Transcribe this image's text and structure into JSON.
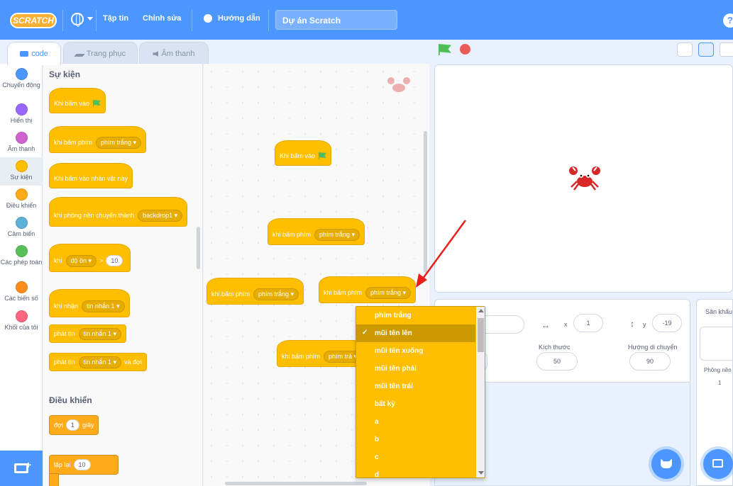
{
  "menubar": {
    "logo": "SCRATCH",
    "file": "Tập tin",
    "edit": "Chỉnh sửa",
    "tutorials": "Hướng dẫn",
    "project_title": "Dự án Scratch",
    "help": "?"
  },
  "tabs": {
    "code": "code",
    "costumes": "Trang phục",
    "sounds": "Âm thanh"
  },
  "categories": [
    {
      "label": "Chuyển động",
      "color": "#4c97ff"
    },
    {
      "label": "Hiển thị",
      "color": "#9966ff"
    },
    {
      "label": "Âm thanh",
      "color": "#cf63cf"
    },
    {
      "label": "Sự kiện",
      "color": "#ffbf00"
    },
    {
      "label": "Điều khiển",
      "color": "#ffab19"
    },
    {
      "label": "Cảm biến",
      "color": "#5cb1d6"
    },
    {
      "label": "Các phép toán",
      "color": "#59c059"
    },
    {
      "label": "Các biến số",
      "color": "#ff8c1a"
    },
    {
      "label": "Khối của tôi",
      "color": "#ff6680"
    }
  ],
  "palette": {
    "events_heading": "Sự kiện",
    "control_heading": "Điều khiển",
    "when_flag_clicked": "Khi bấm vào",
    "when_key_pressed": "khi bấm phím",
    "key_space": "phím trắng",
    "when_sprite_clicked": "Khi bấm vào nhân vật này",
    "when_backdrop_switches": "khi phông nền chuyển thành",
    "backdrop1": "backdrop1",
    "when_loudness": "khi",
    "loudness": "độ ồn",
    "gt": ">",
    "loudness_value": "10",
    "when_receive": "khi nhận",
    "message1": "tin nhắn 1",
    "broadcast": "phát tin",
    "broadcast_wait_suffix": "và đợi",
    "wait": "đợi",
    "wait_value": "1",
    "seconds": "giây",
    "repeat": "lặp lại",
    "repeat_value": "10"
  },
  "scripts": {
    "when_flag_clicked": "Khi bấm vào",
    "when_key_pressed": "khi bấm phím",
    "key_space": "phím trắng",
    "key_space_truncated": "phím trả"
  },
  "dropdown": {
    "options": [
      "phím trắng",
      "mũi tên lên",
      "mũi tên xuống",
      "mũi tên phải",
      "mũi tên trái",
      "bất kỳ",
      "a",
      "b",
      "c",
      "d"
    ],
    "selected_index": 1,
    "check": "✓"
  },
  "sprite_info": {
    "x_label": "x",
    "x_value": "1",
    "y_label": "y",
    "y_value": "-19",
    "size_label": "Kích thước",
    "size_value": "50",
    "direction_label": "Hướng di chuyển",
    "direction_value": "90"
  },
  "stage_pane": {
    "header": "Sân khấu",
    "backdrops_label": "Phông nền",
    "backdrops_count": "1"
  },
  "colors": {
    "menubar": "#4c97ff",
    "events": "#ffbf00",
    "control": "#ffab19",
    "annotation_arrow": "#e8201c"
  }
}
